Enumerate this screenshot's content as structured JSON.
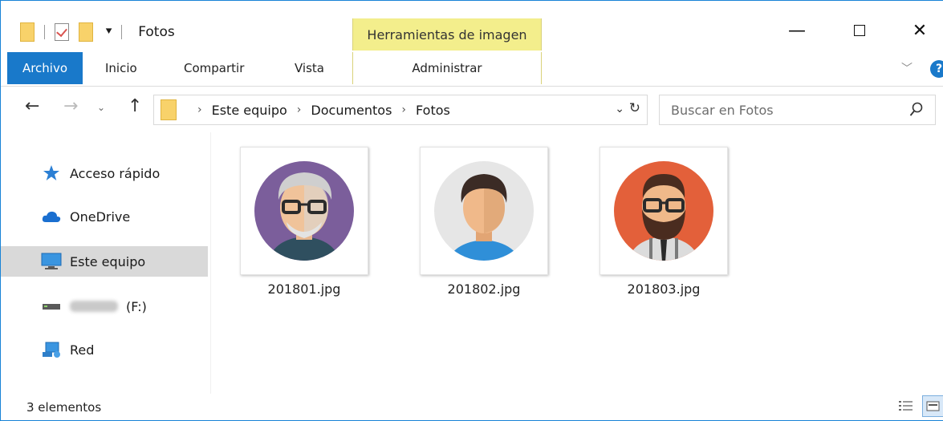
{
  "window": {
    "title": "Fotos",
    "contextual_tab_group": "Herramientas de imagen",
    "controls": {
      "minimize": "—",
      "close": "✕"
    }
  },
  "ribbon": {
    "tabs": [
      {
        "label": "Archivo",
        "active": true
      },
      {
        "label": "Inicio"
      },
      {
        "label": "Compartir"
      },
      {
        "label": "Vista"
      },
      {
        "label": "Administrar"
      }
    ],
    "help": "?"
  },
  "address_bar": {
    "breadcrumbs": [
      "Este equipo",
      "Documentos",
      "Fotos"
    ],
    "search_placeholder": "Buscar en Fotos"
  },
  "nav_pane": {
    "items": [
      {
        "label": "Acceso rápido",
        "icon": "star-icon"
      },
      {
        "label": "OneDrive",
        "icon": "cloud-icon"
      },
      {
        "label": "Este equipo",
        "icon": "computer-icon",
        "selected": true
      },
      {
        "label": "(F:)",
        "icon": "drive-icon"
      },
      {
        "label": "Red",
        "icon": "network-icon"
      }
    ]
  },
  "files": [
    {
      "name": "201801.jpg",
      "bg": "#7b5e9b"
    },
    {
      "name": "201802.jpg",
      "bg": "#e6e6e6"
    },
    {
      "name": "201803.jpg",
      "bg": "#e3603a"
    }
  ],
  "status": {
    "count": "3 elementos"
  },
  "colors": {
    "accent": "#1979ca",
    "contextual_tab": "#f3ee8c",
    "selection": "#d9d9d9"
  }
}
